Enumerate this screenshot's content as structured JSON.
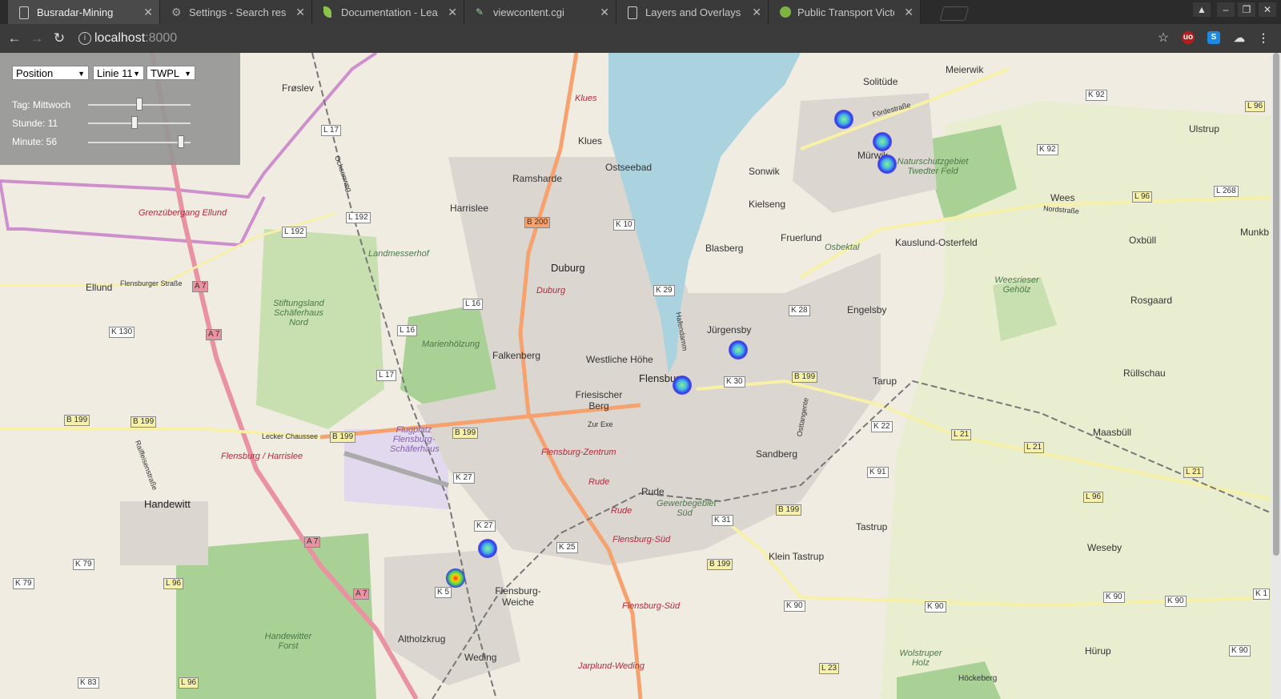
{
  "tabs": [
    {
      "title": "Busradar-Mining",
      "icon": "page-icon",
      "active": true
    },
    {
      "title": "Settings - Search result",
      "icon": "gear-icon"
    },
    {
      "title": "Documentation - Leafle",
      "icon": "leaf-icon"
    },
    {
      "title": "viewcontent.cgi",
      "icon": "document-icon"
    },
    {
      "title": "Layers and Overlays | L",
      "icon": "page-icon"
    },
    {
      "title": "Public Transport Victori",
      "icon": "globe-icon"
    }
  ],
  "toolbar": {
    "url_host": "localhost",
    "url_port": ":8000",
    "ext_ublock": "uo",
    "ext_s": "S"
  },
  "controls": {
    "mode": "Position",
    "line": "Linie 11",
    "stop": "TWPL",
    "day_label": "Tag: Mittwoch",
    "hour_label": "Stunde: 11",
    "minute_label": "Minute: 56",
    "day_value": 0.5,
    "hour_value": 0.45,
    "minute_value": 0.93
  },
  "map": {
    "places": [
      "Frøslev",
      "Solitüde",
      "Meierwik",
      "Klues",
      "Ostseebad",
      "Ramsharde",
      "Harrislee",
      "Sonwik",
      "Mürwik",
      "Kielseng",
      "Wees",
      "Ulstrup",
      "Duburg",
      "Blasberg",
      "Fruerlund",
      "Kauslund-Osterfeld",
      "Oxbüll",
      "Ellund",
      "Engelsby",
      "Jürgensby",
      "Falkenberg",
      "Westliche Höhe",
      "Flensburg",
      "Friesischer Berg",
      "Tarup",
      "Rosgaard",
      "Rüllschau",
      "Sandberg",
      "Maasbüll",
      "Handewitt",
      "Rude",
      "Tastrup",
      "Klein Tastrup",
      "Weseby",
      "Flensburg-Weiche",
      "Altholzkrug",
      "Weding",
      "Hürup",
      "Munkb",
      "Höckeberg"
    ],
    "red_labels": [
      "Grenzübergang Ellund",
      "Klues",
      "Duburg",
      "Flensburg / Harrislee",
      "Flensburg-Zentrum",
      "Rude",
      "Rude",
      "Flensburg-Süd",
      "Flensburg-Süd",
      "Jarplund-Weding"
    ],
    "green_labels": [
      "Landmesserhof",
      "Stiftungsland Schäferhaus Nord",
      "Marienhölzung",
      "Flugplatz Flensburg-Schäferhaus",
      "Osbektal",
      "Naturschutzgebiet Twedter Feld",
      "Weesrieser Gehölz",
      "Gewerbegebiet Süd",
      "Handewitter Forst",
      "Wolstruper Holz"
    ],
    "streets": [
      "Fördestraße",
      "Nordstraße",
      "Flensburger Straße",
      "Lecker Chaussee",
      "Zur Exe",
      "Osttangente",
      "Ochsenweg",
      "Hafendamm",
      "Raiffeisenstraße"
    ],
    "shields": [
      "L 17",
      "L 192",
      "L 192",
      "A 7",
      "A 7",
      "A 7",
      "A 7",
      "K 130",
      "L 16",
      "L 16",
      "L 17",
      "B 199",
      "B 199",
      "B 199",
      "B 199",
      "K 27",
      "K 27",
      "K 5",
      "K 25",
      "K 29",
      "K 28",
      "K 30",
      "B 200",
      "K 10",
      "B 199",
      "K 22",
      "K 91",
      "L 21",
      "L 21",
      "L 21",
      "L 96",
      "L 96",
      "K 31",
      "B 199",
      "B 199",
      "K 90",
      "K 90",
      "K 90",
      "K 90",
      "L 23",
      "K 92",
      "K 92",
      "L 268",
      "L 96",
      "K 79",
      "K 79",
      "L 96",
      "K 83",
      "L 96",
      "K 1",
      "K 90"
    ],
    "bus_markers": 7
  }
}
